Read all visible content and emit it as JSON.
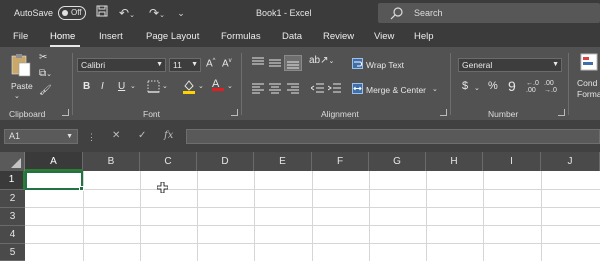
{
  "titlebar": {
    "autosave_label": "AutoSave",
    "autosave_state": "Off",
    "doc_title": "Book1  -  Excel",
    "search_placeholder": "Search"
  },
  "tabs": [
    "File",
    "Home",
    "Insert",
    "Page Layout",
    "Formulas",
    "Data",
    "Review",
    "View",
    "Help"
  ],
  "active_tab": "Home",
  "ribbon": {
    "clipboard": {
      "paste_label": "Paste",
      "group_label": "Clipboard"
    },
    "font": {
      "font_name": "Calibri",
      "font_size": "11",
      "bold": "B",
      "italic": "I",
      "underline": "U",
      "group_label": "Font"
    },
    "alignment": {
      "wrap_text": "Wrap Text",
      "merge_center": "Merge & Center",
      "group_label": "Alignment"
    },
    "number": {
      "format": "General",
      "currency": "$",
      "percent": "%",
      "comma": "9",
      "group_label": "Number"
    },
    "conditional": {
      "line1": "Cond",
      "line2": "Forma"
    }
  },
  "formula_bar": {
    "name_box": "A1",
    "fx_label": "fx",
    "formula_value": ""
  },
  "grid": {
    "columns": [
      "A",
      "B",
      "C",
      "D",
      "E",
      "F",
      "G",
      "H",
      "I",
      "J"
    ],
    "rows": [
      "1",
      "2",
      "3",
      "4",
      "5"
    ],
    "active_cell": "A1"
  },
  "colors": {
    "title_bg": "#3b3b3b",
    "ribbon_bg": "#525252",
    "accent_green": "#217346",
    "highlight_yellow": "#ffd200",
    "font_red": "#e02020"
  }
}
